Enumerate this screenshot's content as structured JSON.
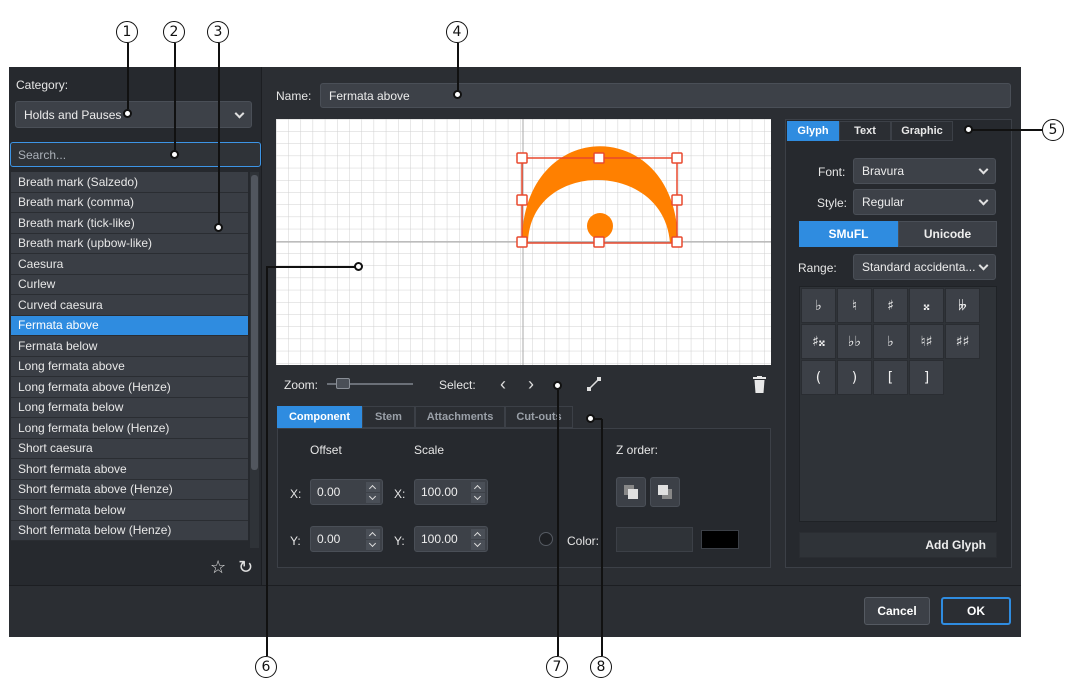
{
  "callouts": [
    "1",
    "2",
    "3",
    "4",
    "5",
    "6",
    "7",
    "8"
  ],
  "left": {
    "category_label": "Category:",
    "category_value": "Holds and Pauses",
    "search_placeholder": "Search...",
    "items": [
      "Breath mark (Salzedo)",
      "Breath mark (comma)",
      "Breath mark (tick-like)",
      "Breath mark (upbow-like)",
      "Caesura",
      "Curlew",
      "Curved caesura",
      "Fermata above",
      "Fermata below",
      "Long fermata above",
      "Long fermata above (Henze)",
      "Long fermata below",
      "Long fermata below (Henze)",
      "Short caesura",
      "Short fermata above",
      "Short fermata above (Henze)",
      "Short fermata below",
      "Short fermata below (Henze)"
    ],
    "selected_index": 7,
    "star_icon": "☆",
    "reset_icon": "↻"
  },
  "name": {
    "label": "Name:",
    "value": "Fermata above"
  },
  "toolbar": {
    "zoom_label": "Zoom:",
    "select_label": "Select:",
    "prev": "‹",
    "next": "›"
  },
  "tabs": [
    "Component",
    "Stem",
    "Attachments",
    "Cut-outs"
  ],
  "component": {
    "offset_label": "Offset",
    "scale_label": "Scale",
    "x_label": "X:",
    "y_label": "Y:",
    "offset_x": "0.00",
    "offset_y": "0.00",
    "scale_x": "100.00",
    "scale_y": "100.00",
    "z_order_label": "Z order:",
    "color_label": "Color:",
    "color_swatch": "#000000"
  },
  "right": {
    "tabs": [
      "Glyph",
      "Text",
      "Graphic"
    ],
    "font_label": "Font:",
    "font_value": "Bravura",
    "style_label": "Style:",
    "style_value": "Regular",
    "seg_smufl": "SMuFL",
    "seg_unicode": "Unicode",
    "range_label": "Range:",
    "range_value": "Standard accidenta...",
    "glyphs": [
      "♭",
      "♮",
      "♯",
      "𝄪",
      "𝄫",
      "♯𝄪",
      "♭♭",
      "♭",
      "♮♯",
      "♯♯",
      "(",
      ")",
      "[",
      "]"
    ],
    "add_glyph": "Add Glyph"
  },
  "buttons": {
    "cancel": "Cancel",
    "ok": "OK"
  },
  "colors": {
    "accent": "#2f8ce0",
    "glyph": "#ff8000",
    "handle": "#e8492e"
  }
}
